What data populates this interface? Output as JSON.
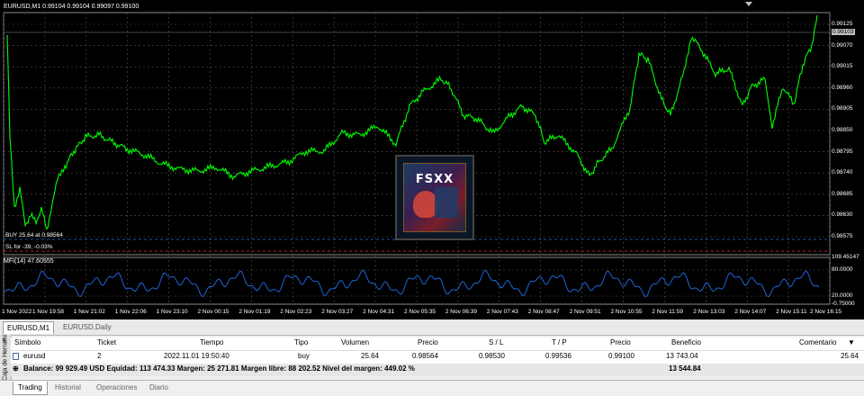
{
  "chart": {
    "title": "EURUSD,M1  0.99104 0.99104 0.99097 0.99100",
    "indicator_title": "MFI(14) 47.60555",
    "trade_label_buy": "BUY 25.64 at 0.98564",
    "trade_label_sl": "SL for -39, -0.03%",
    "current_price": "0.99103",
    "price_ticks": [
      "0.99125",
      "0.99070",
      "0.99015",
      "0.98960",
      "0.98905",
      "0.98850",
      "0.98795",
      "0.98740",
      "0.98685",
      "0.98630",
      "0.98575"
    ],
    "indicator_ticks": [
      "109.45147",
      "80.0000",
      "20.0000",
      "-0.75000"
    ],
    "time_ticks": [
      "1 Nov 2022",
      "1 Nov 19:58",
      "1 Nov 21:02",
      "1 Nov 22:06",
      "1 Nov 23:10",
      "2 Nov 00:15",
      "2 Nov 01:19",
      "2 Nov 02:23",
      "2 Nov 03:27",
      "2 Nov 04:31",
      "2 Nov 05:35",
      "2 Nov 06:39",
      "2 Nov 07:43",
      "2 Nov 08:47",
      "2 Nov 09:51",
      "2 Nov 10:55",
      "2 Nov 11:59",
      "2 Nov 13:03",
      "2 Nov 14:07",
      "2 Nov 15:11",
      "2 Nov 16:15"
    ],
    "logo_text": "FSXX",
    "colors": {
      "price_line": "#00ff00",
      "indicator_line": "#1e6fe8",
      "grid": "#555555",
      "sl_line": "#ff2a2a"
    }
  },
  "chart_tabs": [
    {
      "label": "EURUSD,M1",
      "active": true
    },
    {
      "label": "EURUSD,Daily",
      "active": false
    }
  ],
  "side_panel": {
    "label": "Caja de Herrami",
    "close": "×"
  },
  "terminal": {
    "columns": [
      "Símbolo",
      "Ticket",
      "Tiempo",
      "Tipo",
      "Volumen",
      "Precio",
      "S / L",
      "T / P",
      "Precio",
      "Beneficio",
      "Comentario"
    ],
    "sort_arrow": "▼",
    "rows": [
      {
        "symbol": "eurusd",
        "ticket": "2",
        "time": "2022.11.01 19:50:40",
        "type": "buy",
        "volume": "25.64",
        "price": "0.98564",
        "sl": "0.98530",
        "tp": "0.99536",
        "price_now": "0.99100",
        "profit": "13 743.04",
        "comment": "25.64"
      }
    ],
    "balance_line": "Balance: 99 929.49 USD  Equidad: 113 474.33  Margen: 25 271.81  Margen libre: 88 202.52  Nivel del margen: 449.02 %",
    "balance_profit": "13 544.84"
  },
  "bottom_tabs": [
    {
      "label": "Trading",
      "active": true
    },
    {
      "label": "Historial",
      "active": false
    },
    {
      "label": "Operaciones",
      "active": false
    },
    {
      "label": "Diario",
      "active": false
    }
  ]
}
